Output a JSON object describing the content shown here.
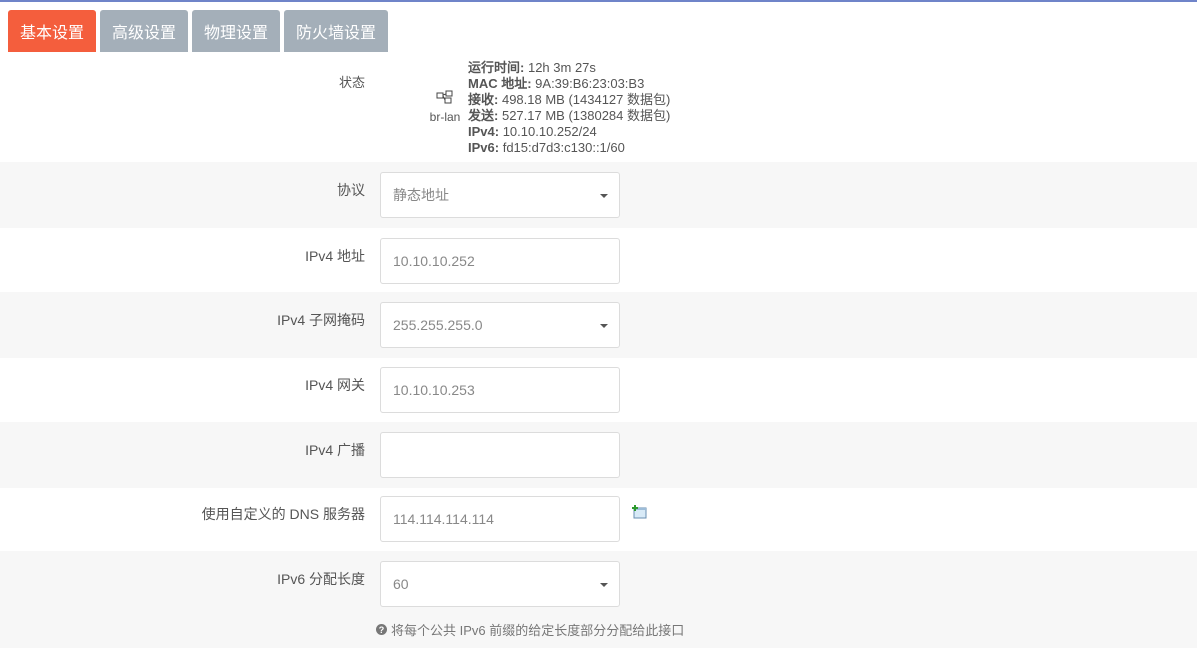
{
  "tabs": [
    {
      "label": "基本设置",
      "active": true
    },
    {
      "label": "高级设置",
      "active": false
    },
    {
      "label": "物理设置",
      "active": false
    },
    {
      "label": "防火墙设置",
      "active": false
    }
  ],
  "status": {
    "label": "状态",
    "interface": "br-lan",
    "interface_icon": "network-bridge-icon",
    "lines": [
      {
        "key": "运行时间:",
        "value": "12h 3m 27s"
      },
      {
        "key": "MAC 地址:",
        "value": "9A:39:B6:23:03:B3"
      },
      {
        "key": "接收:",
        "value": "498.18 MB (1434127 数据包)"
      },
      {
        "key": "发送:",
        "value": "527.17 MB (1380284 数据包)"
      },
      {
        "key": "IPv4:",
        "value": "10.10.10.252/24"
      },
      {
        "key": "IPv6:",
        "value": "fd15:d7d3:c130::1/60"
      }
    ]
  },
  "fields": {
    "protocol": {
      "label": "协议",
      "value": "静态地址"
    },
    "ipv4_address": {
      "label": "IPv4 地址",
      "value": "10.10.10.252"
    },
    "ipv4_netmask": {
      "label": "IPv4 子网掩码",
      "value": "255.255.255.0"
    },
    "ipv4_gateway": {
      "label": "IPv4 网关",
      "value": "10.10.10.253"
    },
    "ipv4_broadcast": {
      "label": "IPv4 广播",
      "value": ""
    },
    "dns": {
      "label": "使用自定义的 DNS 服务器",
      "value": "114.114.114.114"
    },
    "ipv6_assign": {
      "label": "IPv6 分配长度",
      "value": "60"
    }
  },
  "help_text": "将每个公共 IPv6 前缀的给定长度部分分配给此接口",
  "colors": {
    "active_tab": "#f45e3d",
    "inactive_tab": "#a4afb9",
    "top_border": "#6f84c9"
  }
}
